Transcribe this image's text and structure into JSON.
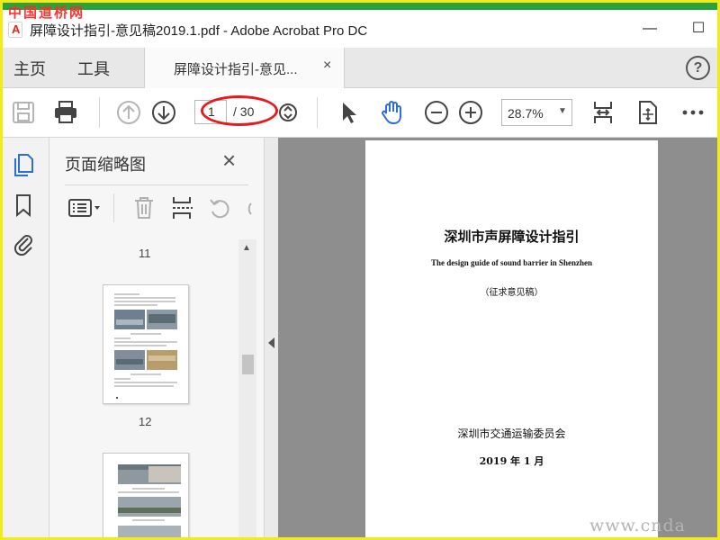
{
  "watermark_top": "中国道桥网",
  "watermark_bottom": "www.cnda",
  "window": {
    "title": "屏障设计指引-意见稿2019.1.pdf - Adobe Acrobat Pro DC",
    "minimize": "—",
    "maximize": "☐"
  },
  "menu": {
    "home": "主页",
    "tools": "工具"
  },
  "tab": {
    "label": "屏障设计指引-意见...",
    "close": "×"
  },
  "help": "?",
  "toolbar": {
    "page_current": "1",
    "page_total": "/ 30",
    "zoom": "28.7%"
  },
  "panel": {
    "title": "页面缩略图",
    "close": "×",
    "thumbs": [
      {
        "label": "11"
      },
      {
        "label": "12"
      }
    ]
  },
  "page": {
    "title": "深圳市声屏障设计指引",
    "subtitle": "The design guide of sound barrier in Shenzhen",
    "note": "（征求意见稿）",
    "org": "深圳市交通运输委员会",
    "date": "2019 年 1 月"
  },
  "colors": {
    "accent": "#2b6fd6",
    "annotation": "#e61b1b",
    "border": "#f2ea1a",
    "topbar": "#2aa33c"
  }
}
